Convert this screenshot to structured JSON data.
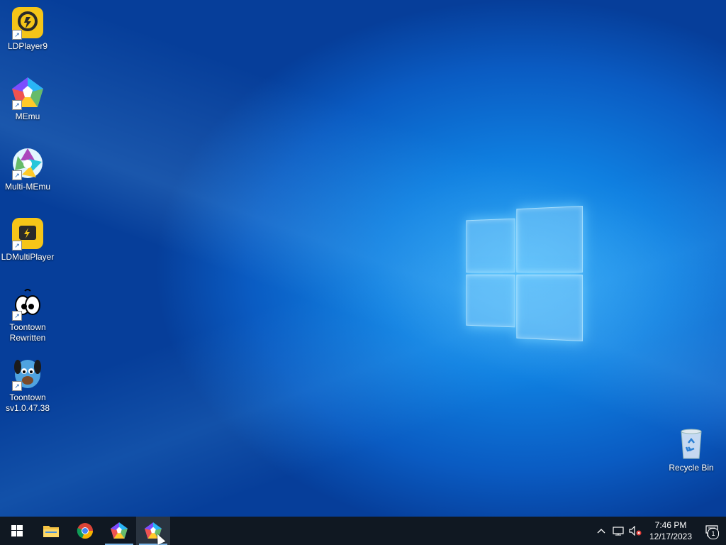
{
  "desktop": {
    "icons": [
      {
        "label": "LDPlayer9",
        "icon": "ldplayer9-icon"
      },
      {
        "label": "MEmu",
        "icon": "memu-icon"
      },
      {
        "label": "Multi-MEmu",
        "icon": "multi-memu-icon"
      },
      {
        "label": "LDMultiPlayer",
        "icon": "ldmultiplayer-icon"
      },
      {
        "label": "Toontown Rewritten",
        "icon": "toontown-rewritten-icon"
      },
      {
        "label": "Toontown sv1.0.47.38",
        "icon": "toontown-icon"
      }
    ],
    "recycle_bin": {
      "label": "Recycle Bin",
      "icon": "recycle-bin-icon"
    }
  },
  "taskbar": {
    "apps": [
      {
        "name": "start-button",
        "icon": "windows-logo-icon"
      },
      {
        "name": "file-explorer",
        "icon": "folder-icon"
      },
      {
        "name": "chrome",
        "icon": "chrome-icon"
      },
      {
        "name": "memu",
        "icon": "memu-icon"
      },
      {
        "name": "multi-memu",
        "icon": "multi-memu-icon",
        "active": true
      }
    ],
    "tray": {
      "time": "7:46 PM",
      "date": "12/17/2023",
      "notification_count": "1"
    }
  },
  "colors": {
    "taskbar_bg": "#101822",
    "desktop_accent": "#0f7fe0"
  }
}
